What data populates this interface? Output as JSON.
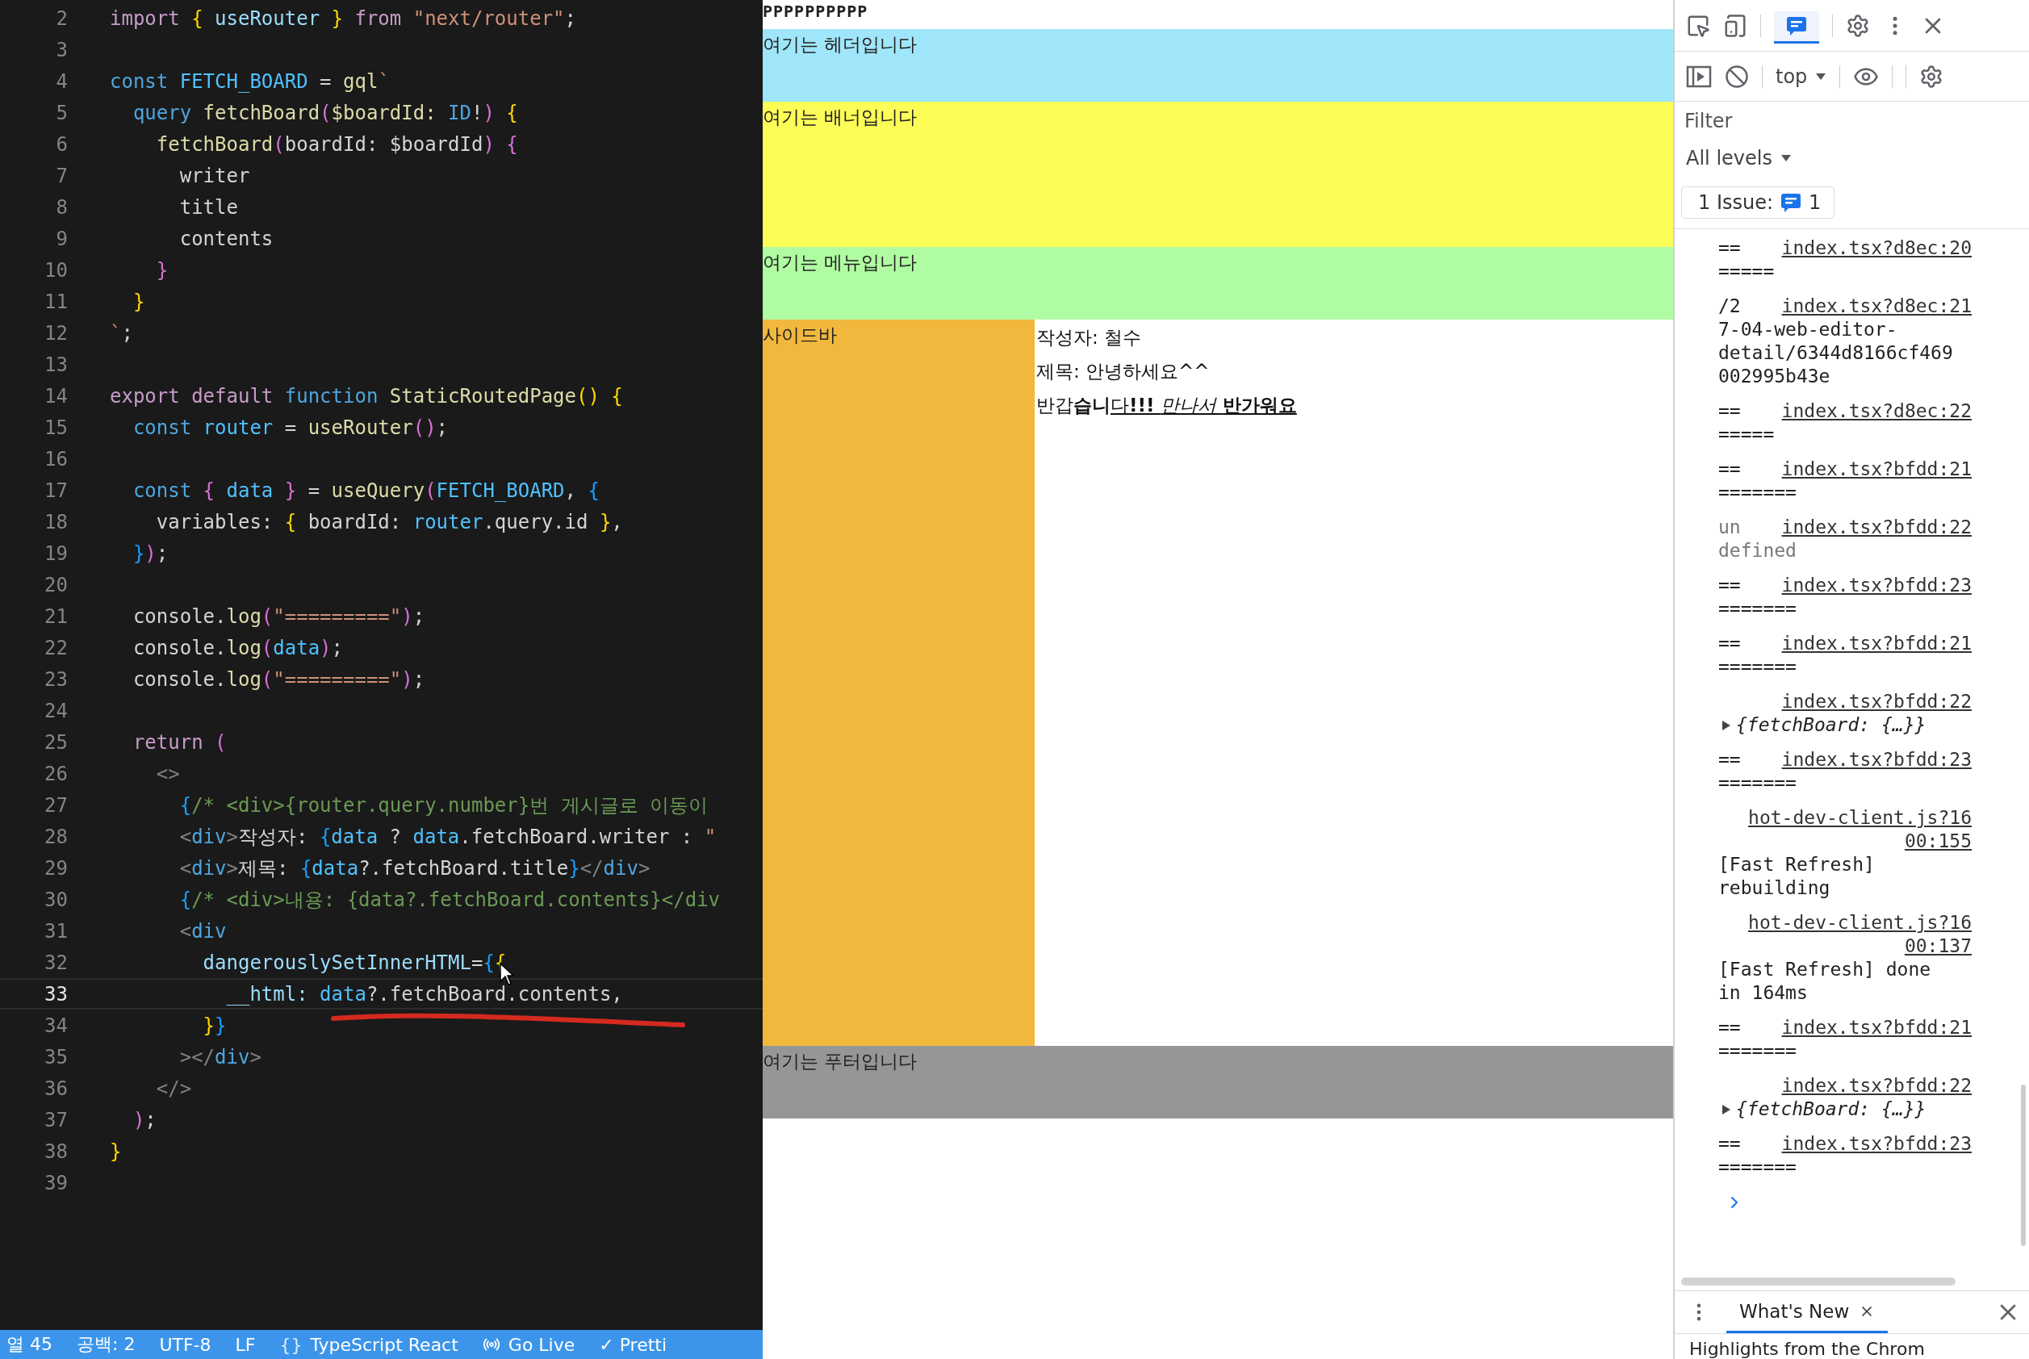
{
  "editor": {
    "lines": [
      {
        "n": "2",
        "current": false,
        "tokens": [
          {
            "kind": "kw",
            "text": "import "
          },
          {
            "kind": "b1",
            "text": "{ "
          },
          {
            "kind": "var",
            "text": "useRouter "
          },
          {
            "kind": "b1",
            "text": "} "
          },
          {
            "kind": "kw",
            "text": "from "
          },
          {
            "kind": "str",
            "text": "\"next/router\""
          },
          {
            "kind": "p",
            "text": ";"
          }
        ]
      },
      {
        "n": "3",
        "current": false
      },
      {
        "n": "4",
        "current": false,
        "tokens": [
          {
            "kind": "decl",
            "text": "const "
          },
          {
            "kind": "cst",
            "text": "FETCH_BOARD"
          },
          {
            "kind": "p",
            "text": " = "
          },
          {
            "kind": "fn",
            "text": "gql"
          },
          {
            "kind": "str",
            "text": "`"
          }
        ]
      },
      {
        "n": "5",
        "current": false,
        "tokens": [
          {
            "kind": "decl",
            "text": "  query "
          },
          {
            "kind": "fn",
            "text": "fetchBoard"
          },
          {
            "kind": "b2",
            "text": "("
          },
          {
            "kind": "fn",
            "text": "$boardId: "
          },
          {
            "kind": "decl",
            "text": "ID"
          },
          {
            "kind": "p",
            "text": "!"
          },
          {
            "kind": "b2",
            "text": ")"
          },
          {
            "kind": "b1",
            "text": " {"
          }
        ]
      },
      {
        "n": "6",
        "current": false,
        "tokens": [
          {
            "kind": "fn",
            "text": "    fetchBoard"
          },
          {
            "kind": "b2",
            "text": "("
          },
          {
            "kind": "p",
            "text": "boardId: $boardId"
          },
          {
            "kind": "b2",
            "text": ")"
          },
          {
            "kind": "b2",
            "text": " {"
          }
        ]
      },
      {
        "n": "7",
        "current": false,
        "tokens": [
          {
            "kind": "p",
            "text": "      writer"
          }
        ]
      },
      {
        "n": "8",
        "current": false,
        "tokens": [
          {
            "kind": "p",
            "text": "      title"
          }
        ]
      },
      {
        "n": "9",
        "current": false,
        "tokens": [
          {
            "kind": "p",
            "text": "      contents"
          }
        ]
      },
      {
        "n": "10",
        "current": false,
        "tokens": [
          {
            "kind": "b2",
            "text": "    }"
          }
        ]
      },
      {
        "n": "11",
        "current": false,
        "tokens": [
          {
            "kind": "b1",
            "text": "  }"
          }
        ]
      },
      {
        "n": "12",
        "current": false,
        "tokens": [
          {
            "kind": "str",
            "text": "`"
          },
          {
            "kind": "p",
            "text": ";"
          }
        ]
      },
      {
        "n": "13",
        "current": false
      },
      {
        "n": "14",
        "current": false,
        "tokens": [
          {
            "kind": "kw",
            "text": "export default "
          },
          {
            "kind": "decl",
            "text": "function "
          },
          {
            "kind": "fn",
            "text": "StaticRoutedPage"
          },
          {
            "kind": "b1",
            "text": "() {"
          }
        ]
      },
      {
        "n": "15",
        "current": false,
        "tokens": [
          {
            "kind": "decl",
            "text": "  const "
          },
          {
            "kind": "cst",
            "text": "router"
          },
          {
            "kind": "p",
            "text": " = "
          },
          {
            "kind": "fn",
            "text": "useRouter"
          },
          {
            "kind": "b2",
            "text": "()"
          },
          {
            "kind": "p",
            "text": ";"
          }
        ]
      },
      {
        "n": "16",
        "current": false
      },
      {
        "n": "17",
        "current": false,
        "tokens": [
          {
            "kind": "decl",
            "text": "  const "
          },
          {
            "kind": "b2",
            "text": "{ "
          },
          {
            "kind": "cst",
            "text": "data "
          },
          {
            "kind": "b2",
            "text": "}"
          },
          {
            "kind": "p",
            "text": " = "
          },
          {
            "kind": "fn",
            "text": "useQuery"
          },
          {
            "kind": "b2",
            "text": "("
          },
          {
            "kind": "cst",
            "text": "FETCH_BOARD"
          },
          {
            "kind": "p",
            "text": ", "
          },
          {
            "kind": "b3",
            "text": "{"
          }
        ]
      },
      {
        "n": "18",
        "current": false,
        "tokens": [
          {
            "kind": "p",
            "text": "    variables: "
          },
          {
            "kind": "b1",
            "text": "{ "
          },
          {
            "kind": "p",
            "text": "boardId: "
          },
          {
            "kind": "cst",
            "text": "router"
          },
          {
            "kind": "p",
            "text": ".query.id "
          },
          {
            "kind": "b1",
            "text": "}"
          },
          {
            "kind": "p",
            "text": ","
          }
        ]
      },
      {
        "n": "19",
        "current": false,
        "tokens": [
          {
            "kind": "b3",
            "text": "  }"
          },
          {
            "kind": "b2",
            "text": ")"
          },
          {
            "kind": "p",
            "text": ";"
          }
        ]
      },
      {
        "n": "20",
        "current": false
      },
      {
        "n": "21",
        "current": false,
        "tokens": [
          {
            "kind": "p",
            "text": "  console."
          },
          {
            "kind": "fn",
            "text": "log"
          },
          {
            "kind": "b2",
            "text": "("
          },
          {
            "kind": "str",
            "text": "\"=========\""
          },
          {
            "kind": "b2",
            "text": ")"
          },
          {
            "kind": "p",
            "text": ";"
          }
        ]
      },
      {
        "n": "22",
        "current": false,
        "tokens": [
          {
            "kind": "p",
            "text": "  console."
          },
          {
            "kind": "fn",
            "text": "log"
          },
          {
            "kind": "b2",
            "text": "("
          },
          {
            "kind": "cst",
            "text": "data"
          },
          {
            "kind": "b2",
            "text": ")"
          },
          {
            "kind": "p",
            "text": ";"
          }
        ]
      },
      {
        "n": "23",
        "current": false,
        "tokens": [
          {
            "kind": "p",
            "text": "  console."
          },
          {
            "kind": "fn",
            "text": "log"
          },
          {
            "kind": "b2",
            "text": "("
          },
          {
            "kind": "str",
            "text": "\"=========\""
          },
          {
            "kind": "b2",
            "text": ")"
          },
          {
            "kind": "p",
            "text": ";"
          }
        ]
      },
      {
        "n": "24",
        "current": false
      },
      {
        "n": "25",
        "current": false,
        "tokens": [
          {
            "kind": "kw",
            "text": "  return "
          },
          {
            "kind": "b2",
            "text": "("
          }
        ]
      },
      {
        "n": "26",
        "current": false,
        "tokens": [
          {
            "kind": "tag",
            "text": "    <>"
          }
        ]
      },
      {
        "n": "27",
        "current": false,
        "tokens": [
          {
            "kind": "b3",
            "text": "      {"
          },
          {
            "kind": "cm",
            "text": "/* <div>{router.query.number}번 게시글로 이동이"
          }
        ]
      },
      {
        "n": "28",
        "current": false,
        "tokens": [
          {
            "kind": "tag",
            "text": "      <"
          },
          {
            "kind": "tn",
            "text": "div"
          },
          {
            "kind": "tag",
            "text": ">"
          },
          {
            "kind": "p",
            "text": "작성자: "
          },
          {
            "kind": "b3",
            "text": "{"
          },
          {
            "kind": "cst",
            "text": "data"
          },
          {
            "kind": "p",
            "text": " ? "
          },
          {
            "kind": "cst",
            "text": "data"
          },
          {
            "kind": "p",
            "text": ".fetchBoard.writer : "
          },
          {
            "kind": "str",
            "text": "\""
          }
        ]
      },
      {
        "n": "29",
        "current": false,
        "tokens": [
          {
            "kind": "tag",
            "text": "      <"
          },
          {
            "kind": "tn",
            "text": "div"
          },
          {
            "kind": "tag",
            "text": ">"
          },
          {
            "kind": "p",
            "text": "제목: "
          },
          {
            "kind": "b3",
            "text": "{"
          },
          {
            "kind": "cst",
            "text": "data"
          },
          {
            "kind": "p",
            "text": "?.fetchBoard.title"
          },
          {
            "kind": "b3",
            "text": "}"
          },
          {
            "kind": "tag",
            "text": "</"
          },
          {
            "kind": "tn",
            "text": "div"
          },
          {
            "kind": "tag",
            "text": ">"
          }
        ]
      },
      {
        "n": "30",
        "current": false,
        "tokens": [
          {
            "kind": "b3",
            "text": "      {"
          },
          {
            "kind": "cm",
            "text": "/* <div>내용: {data?.fetchBoard.contents}</div"
          }
        ]
      },
      {
        "n": "31",
        "current": false,
        "tokens": [
          {
            "kind": "tag",
            "text": "      <"
          },
          {
            "kind": "tn",
            "text": "div"
          }
        ]
      },
      {
        "n": "32",
        "current": false,
        "tokens": [
          {
            "kind": "prop",
            "text": "        dangerouslySetInnerHTML"
          },
          {
            "kind": "p",
            "text": "="
          },
          {
            "kind": "b3",
            "text": "{"
          },
          {
            "kind": "b1",
            "text": "{"
          }
        ]
      },
      {
        "n": "33",
        "current": true,
        "tokens": [
          {
            "kind": "prop",
            "text": "          __html: "
          },
          {
            "kind": "cst",
            "text": "data"
          },
          {
            "kind": "p",
            "text": "?.fetchBoard.contents,"
          }
        ]
      },
      {
        "n": "34",
        "current": false,
        "tokens": [
          {
            "kind": "b1",
            "text": "        }"
          },
          {
            "kind": "b3",
            "text": "}"
          }
        ]
      },
      {
        "n": "35",
        "current": false,
        "tokens": [
          {
            "kind": "tag",
            "text": "      ></"
          },
          {
            "kind": "tn",
            "text": "div"
          },
          {
            "kind": "tag",
            "text": ">"
          }
        ]
      },
      {
        "n": "36",
        "current": false,
        "tokens": [
          {
            "kind": "tag",
            "text": "    </>"
          }
        ]
      },
      {
        "n": "37",
        "current": false,
        "tokens": [
          {
            "kind": "b2",
            "text": "  )"
          },
          {
            "kind": "p",
            "text": ";"
          }
        ]
      },
      {
        "n": "38",
        "current": false,
        "tokens": [
          {
            "kind": "b1",
            "text": "}"
          }
        ]
      },
      {
        "n": "39",
        "current": false
      }
    ]
  },
  "status_bar": [
    {
      "kind": "text",
      "label": "열 45"
    },
    {
      "kind": "text",
      "label": "공백: 2"
    },
    {
      "kind": "text",
      "label": "UTF-8"
    },
    {
      "kind": "text",
      "label": "LF"
    },
    {
      "kind": "language",
      "glyph": "{}",
      "label": "TypeScript React"
    },
    {
      "kind": "broadcast",
      "label": "Go Live"
    },
    {
      "kind": "text",
      "label": "✓ Pretti"
    }
  ],
  "page": {
    "top_text": "PPPPPPPPPP",
    "regions": [
      {
        "kind": "header",
        "text": "여기는 헤더입니다",
        "color": "#a0e6fa"
      },
      {
        "kind": "banner",
        "text": "여기는 배너입니다",
        "color": "#fdfd58"
      },
      {
        "kind": "menu",
        "text": "여기는 메뉴입니다",
        "color": "#b0fca2"
      },
      {
        "kind": "body",
        "text": "사이드바",
        "color": "#f2b83e",
        "content": {
          "writer": "작성자: 철수",
          "title": "제목: 안녕하세요^^",
          "contents": [
            {
              "text": "반갑",
              "bold": false,
              "italic": false,
              "underline": false
            },
            {
              "text": "습니",
              "bold": true,
              "italic": false,
              "underline": false
            },
            {
              "text": "다",
              "bold": false,
              "italic": false,
              "underline": true
            },
            {
              "text": "!!! ",
              "bold": true,
              "italic": false,
              "underline": true
            },
            {
              "text": "만나서 ",
              "bold": false,
              "italic": true,
              "underline": true
            },
            {
              "text": "반가워요",
              "bold": true,
              "italic": false,
              "underline": true
            }
          ]
        }
      },
      {
        "kind": "footer",
        "text": "여기는 푸터입니다",
        "color": "#969696"
      }
    ]
  },
  "devtools": {
    "tabs": [
      {
        "kind": "console",
        "selected": true
      }
    ],
    "context": "top",
    "filter": {
      "placeholder": "Filter"
    },
    "levels": "All levels",
    "issues": {
      "label": "1 Issue:",
      "count": "1"
    },
    "log": [
      {
        "kind": "text",
        "prefix": "==",
        "link": "index.tsx?d8ec:20",
        "body": "====="
      },
      {
        "kind": "text",
        "prefix": "/2",
        "link": "index.tsx?d8ec:21",
        "body": "7-04-web-editor-\ndetail/6344d8166cf469\n002995b43e"
      },
      {
        "kind": "text",
        "prefix": "==",
        "link": "index.tsx?d8ec:22",
        "body": "====="
      },
      {
        "kind": "text",
        "prefix": "==",
        "link": "index.tsx?bfdd:21",
        "body": "======="
      },
      {
        "kind": "muted",
        "prefix": "un",
        "link": "index.tsx?bfdd:22",
        "body": "defined"
      },
      {
        "kind": "text",
        "prefix": "==",
        "link": "index.tsx?bfdd:23",
        "body": "======="
      },
      {
        "kind": "text",
        "prefix": "==",
        "link": "index.tsx?bfdd:21",
        "body": "======="
      },
      {
        "kind": "object",
        "link": "index.tsx?bfdd:22",
        "body": "{fetchBoard: {…}}"
      },
      {
        "kind": "text",
        "prefix": "==",
        "link": "index.tsx?bfdd:23",
        "body": "======="
      },
      {
        "kind": "text",
        "link": "hot-dev-client.js?16\n00:155",
        "body": "[Fast Refresh]\nrebuilding"
      },
      {
        "kind": "text",
        "link": "hot-dev-client.js?16\n00:137",
        "body": "[Fast Refresh] done\nin 164ms"
      },
      {
        "kind": "text",
        "prefix": "==",
        "link": "index.tsx?bfdd:21",
        "body": "======="
      },
      {
        "kind": "object",
        "link": "index.tsx?bfdd:22",
        "body": "{fetchBoard: {…}}"
      },
      {
        "kind": "text",
        "prefix": "==",
        "link": "index.tsx?bfdd:23",
        "body": "======="
      }
    ],
    "drawer": {
      "tabs": [
        {
          "label": "What's New",
          "selected": true
        }
      ],
      "text": "Highlights from the Chrom"
    }
  }
}
